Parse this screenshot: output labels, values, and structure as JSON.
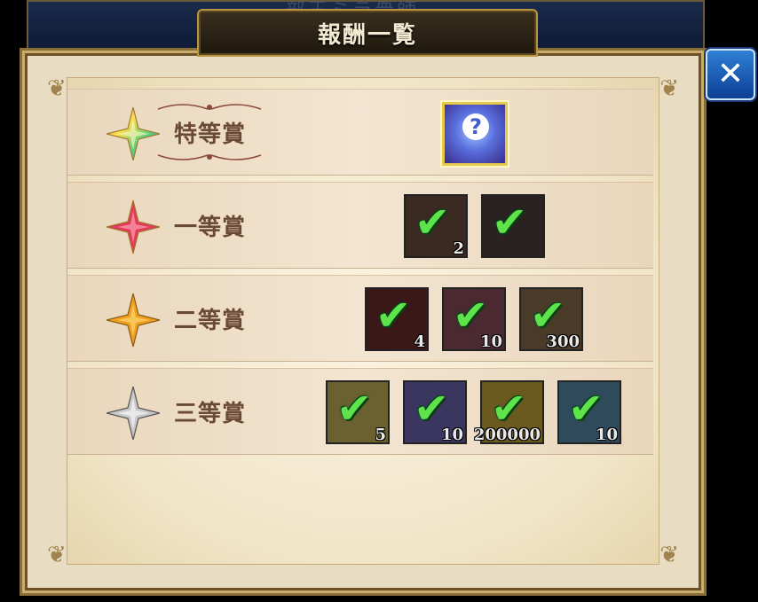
{
  "header": {
    "title": "報酬一覧",
    "background_text": "部王ミラ衆師"
  },
  "close_button": {
    "label": "✕"
  },
  "prizes": [
    {
      "label": "特等賞",
      "star_color": "#f4d24b",
      "rewards": [
        {
          "icon": "mystery-crystal-icon",
          "qty": ""
        }
      ]
    },
    {
      "label": "一等賞",
      "star_color": "#e33a5a",
      "rewards": [
        {
          "icon": "item-icon",
          "qty": "2",
          "tint": "#3a2a22"
        },
        {
          "icon": "item-icon",
          "qty": "",
          "tint": "#2a2220"
        }
      ]
    },
    {
      "label": "二等賞",
      "star_color": "#f0a020",
      "rewards": [
        {
          "icon": "item-icon",
          "qty": "4",
          "tint": "#3a1818"
        },
        {
          "icon": "item-icon",
          "qty": "10",
          "tint": "#4a2a30"
        },
        {
          "icon": "item-icon",
          "qty": "300",
          "tint": "#4a3b28"
        }
      ]
    },
    {
      "label": "三等賞",
      "star_color": "#c8c8c8",
      "rewards": [
        {
          "icon": "item-icon",
          "qty": "5",
          "tint": "#6a6030"
        },
        {
          "icon": "item-icon",
          "qty": "10",
          "tint": "#3a3660"
        },
        {
          "icon": "item-icon",
          "qty": "200000",
          "tint": "#6a5a20"
        },
        {
          "icon": "item-icon",
          "qty": "10",
          "tint": "#2f4a5a"
        }
      ]
    }
  ]
}
